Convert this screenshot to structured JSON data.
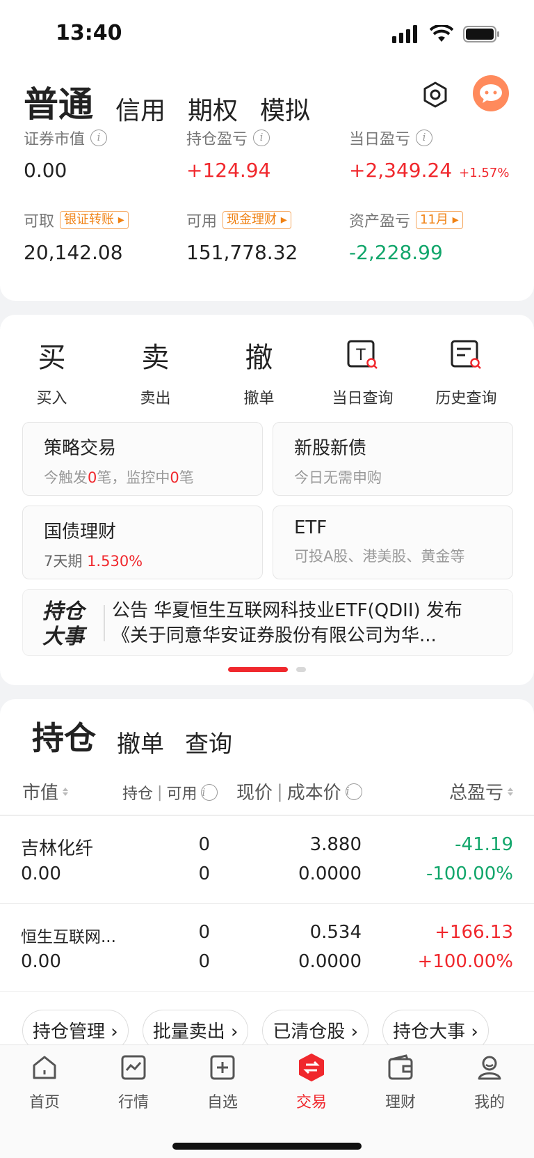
{
  "status": {
    "time": "13:40"
  },
  "header": {
    "tabs": [
      "普通",
      "信用",
      "期权",
      "模拟"
    ],
    "active_tab": "普通"
  },
  "account": {
    "market_value": {
      "label": "证券市值",
      "value": "0.00"
    },
    "position_pl": {
      "label": "持仓盈亏",
      "value": "+124.94"
    },
    "daily_pl": {
      "label": "当日盈亏",
      "value": "+2,349.24",
      "pct": "+1.57%"
    },
    "withdrawable": {
      "label": "可取",
      "tag": "银证转账",
      "value": "20,142.08"
    },
    "available": {
      "label": "可用",
      "tag": "现金理财",
      "value": "151,778.32"
    },
    "asset_pl": {
      "label": "资产盈亏",
      "tag": "11月",
      "value": "-2,228.99"
    }
  },
  "actions": [
    {
      "label": "买入",
      "glyph": "买"
    },
    {
      "label": "卖出",
      "glyph": "卖"
    },
    {
      "label": "撤单",
      "glyph": "撤"
    },
    {
      "label": "当日查询",
      "glyph": "T"
    },
    {
      "label": "历史查询",
      "glyph": ""
    }
  ],
  "tiles": {
    "strategy": {
      "title": "策略交易",
      "sub_a": "今触发",
      "sub_n1": "0",
      "sub_b": "笔，监控中",
      "sub_n2": "0",
      "sub_c": "笔"
    },
    "ipo": {
      "title": "新股新债",
      "sub": "今日无需申购"
    },
    "bond": {
      "title": "国债理财",
      "sub": "7天期",
      "rate": "1.530%"
    },
    "etf": {
      "title": "ETF",
      "sub": "可投A股、港美股、黄金等"
    }
  },
  "notice": {
    "badge_1": "持仓",
    "badge_2": "大事",
    "line1": "公告 华夏恒生互联网科技业ETF(QDII) 发布",
    "line2": "《关于同意华安证券股份有限公司为华..."
  },
  "holdings": {
    "tabs": [
      "持仓",
      "撤单",
      "查询"
    ],
    "columns": {
      "mv": "市值",
      "pos": "持仓",
      "avail": "可用",
      "price": "现价",
      "cost": "成本价",
      "total": "总盈亏"
    },
    "rows": [
      {
        "name": "吉林化纤",
        "mv": "0.00",
        "pos": "0",
        "avail": "0",
        "price": "3.880",
        "cost": "0.0000",
        "pl": "-41.19",
        "pl_pct": "-100.00%"
      },
      {
        "name": "恒生互联网...",
        "mv": "0.00",
        "pos": "0",
        "avail": "0",
        "price": "0.534",
        "cost": "0.0000",
        "pl": "+166.13",
        "pl_pct": "+100.00%"
      }
    ],
    "buttons": [
      "持仓管理",
      "批量卖出",
      "已清仓股",
      "持仓大事"
    ]
  },
  "nav": [
    {
      "label": "首页",
      "icon": "home-icon"
    },
    {
      "label": "行情",
      "icon": "chart-icon"
    },
    {
      "label": "自选",
      "icon": "add-square-icon"
    },
    {
      "label": "交易",
      "icon": "trade-icon"
    },
    {
      "label": "理财",
      "icon": "wallet-icon"
    },
    {
      "label": "我的",
      "icon": "profile-icon"
    }
  ],
  "colors": {
    "accent": "#f0282d",
    "gain": "#f0282d",
    "loss": "#12a66b",
    "tag": "#f08214"
  }
}
